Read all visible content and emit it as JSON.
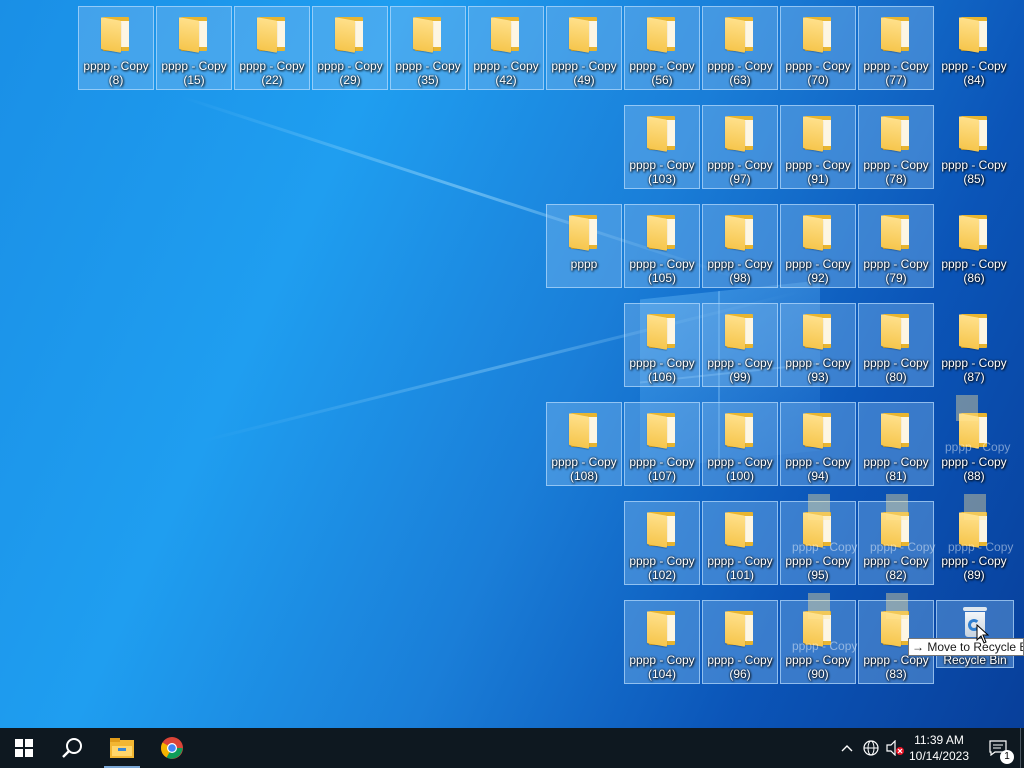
{
  "desktop": {
    "icons": [
      {
        "line1": "pppp - Copy",
        "line2": "(8)",
        "selected": true
      },
      {
        "line1": "pppp - Copy",
        "line2": "(15)",
        "selected": true
      },
      {
        "line1": "pppp - Copy",
        "line2": "(22)",
        "selected": true
      },
      {
        "line1": "pppp - Copy",
        "line2": "(29)",
        "selected": true
      },
      {
        "line1": "pppp - Copy",
        "line2": "(35)",
        "selected": true
      },
      {
        "line1": "pppp - Copy",
        "line2": "(42)",
        "selected": true
      },
      {
        "line1": "pppp - Copy",
        "line2": "(49)",
        "selected": true
      },
      {
        "line1": "pppp - Copy",
        "line2": "(56)",
        "selected": true
      },
      {
        "line1": "pppp - Copy",
        "line2": "(63)",
        "selected": true
      },
      {
        "line1": "pppp - Copy",
        "line2": "(70)",
        "selected": true
      },
      {
        "line1": "pppp - Copy",
        "line2": "(77)",
        "selected": true
      },
      {
        "line1": "pppp - Copy",
        "line2": "(84)",
        "selected": false
      },
      {
        "line1": "pppp - Copy",
        "line2": "(103)",
        "selected": true
      },
      {
        "line1": "pppp - Copy",
        "line2": "(97)",
        "selected": true
      },
      {
        "line1": "pppp - Copy",
        "line2": "(91)",
        "selected": true
      },
      {
        "line1": "pppp - Copy",
        "line2": "(78)",
        "selected": true
      },
      {
        "line1": "pppp - Copy",
        "line2": "(85)",
        "selected": false
      },
      {
        "line1": "pppp",
        "line2": "",
        "selected": true
      },
      {
        "line1": "pppp - Copy",
        "line2": "(105)",
        "selected": true
      },
      {
        "line1": "pppp - Copy",
        "line2": "(98)",
        "selected": true
      },
      {
        "line1": "pppp - Copy",
        "line2": "(92)",
        "selected": true
      },
      {
        "line1": "pppp - Copy",
        "line2": "(79)",
        "selected": true
      },
      {
        "line1": "pppp - Copy",
        "line2": "(86)",
        "selected": false
      },
      {
        "line1": "pppp - Copy",
        "line2": "(106)",
        "selected": true
      },
      {
        "line1": "pppp - Copy",
        "line2": "(99)",
        "selected": true
      },
      {
        "line1": "pppp - Copy",
        "line2": "(93)",
        "selected": true
      },
      {
        "line1": "pppp - Copy",
        "line2": "(80)",
        "selected": true
      },
      {
        "line1": "pppp - Copy",
        "line2": "(87)",
        "selected": false
      },
      {
        "line1": "pppp - Copy",
        "line2": "(108)",
        "selected": true
      },
      {
        "line1": "pppp - Copy",
        "line2": "(107)",
        "selected": true
      },
      {
        "line1": "pppp - Copy",
        "line2": "(100)",
        "selected": true
      },
      {
        "line1": "pppp - Copy",
        "line2": "(94)",
        "selected": true
      },
      {
        "line1": "pppp - Copy",
        "line2": "(81)",
        "selected": true
      },
      {
        "line1": "pppp - Copy",
        "line2": "(88)",
        "selected": false
      },
      {
        "line1": "pppp - Copy",
        "line2": "(102)",
        "selected": true
      },
      {
        "line1": "pppp - Copy",
        "line2": "(101)",
        "selected": true
      },
      {
        "line1": "pppp - Copy",
        "line2": "(95)",
        "selected": true
      },
      {
        "line1": "pppp - Copy",
        "line2": "(82)",
        "selected": true
      },
      {
        "line1": "pppp - Copy",
        "line2": "(89)",
        "selected": false
      },
      {
        "line1": "pppp - Copy",
        "line2": "(104)",
        "selected": true
      },
      {
        "line1": "pppp - Copy",
        "line2": "(96)",
        "selected": true
      },
      {
        "line1": "pppp - Copy",
        "line2": "(90)",
        "selected": true
      },
      {
        "line1": "pppp - Copy",
        "line2": "(83)",
        "selected": true
      }
    ],
    "recycle_bin": {
      "label": "Recycle Bin",
      "icon": "recycle-bin-icon"
    },
    "drag_ghost_label": "pppp - Copy",
    "tooltip": {
      "arrow": "→",
      "text": "Move to Recycle Bin"
    }
  },
  "taskbar": {
    "start_icon": "windows-logo-icon",
    "search_icon": "search-icon",
    "pinned": [
      {
        "name": "File Explorer",
        "icon": "file-explorer-icon"
      },
      {
        "name": "Google Chrome",
        "icon": "chrome-icon"
      }
    ],
    "tray_icons": [
      "chevron-up-icon",
      "network-icon",
      "volume-muted-icon"
    ],
    "clock": {
      "time": "11:39 AM",
      "date": "10/14/2023"
    },
    "notification_count": "1"
  },
  "colors": {
    "desktop_bg": "#1a8fe6",
    "selection_fill": "#87bef0",
    "taskbar_bg": "#0e1820",
    "folder_yellow": "#f6c64d"
  }
}
